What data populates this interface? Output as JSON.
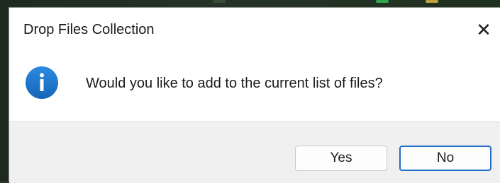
{
  "window": {
    "title": "Drop Files Collection",
    "close_glyph": "✕"
  },
  "content": {
    "icon": "info-icon",
    "message": "Would you like to add to the current list of files?"
  },
  "buttons": {
    "yes_label": "Yes",
    "no_label": "No",
    "default": "No"
  },
  "colors": {
    "info_icon": "#1f7ad1",
    "default_button_border": "#1f6fc7",
    "dialog_background": "#ffffff",
    "footer_background": "#f0f0f0"
  }
}
